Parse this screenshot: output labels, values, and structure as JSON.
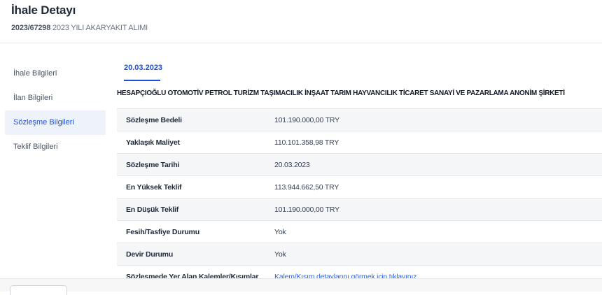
{
  "header": {
    "title": "İhale Detayı",
    "reference": "2023/67298",
    "description": "2023 YILI AKARYAKIT ALIMI"
  },
  "sidebar": {
    "items": [
      {
        "label": "İhale Bilgileri",
        "active": false
      },
      {
        "label": "İlan Bilgileri",
        "active": false
      },
      {
        "label": "Sözleşme Bilgileri",
        "active": true
      },
      {
        "label": "Teklif Bilgileri",
        "active": false
      }
    ]
  },
  "tabs": [
    {
      "label": "20.03.2023",
      "active": true
    }
  ],
  "contract": {
    "company": "HESAPÇIOĞLU OTOMOTİV PETROL TURİZM TAŞIMACILIK İNŞAAT TARIM HAYVANCILIK TİCARET SANAYİ VE PAZARLAMA ANONİM ŞİRKETİ",
    "rows": [
      {
        "label": "Sözleşme Bedeli",
        "value": "101.190.000,00 TRY"
      },
      {
        "label": "Yaklaşık Maliyet",
        "value": "110.101.358,98 TRY"
      },
      {
        "label": "Sözleşme Tarihi",
        "value": "20.03.2023"
      },
      {
        "label": "En Yüksek Teklif",
        "value": "113.944.662,50 TRY"
      },
      {
        "label": "En Düşük Teklif",
        "value": "101.190.000,00 TRY"
      },
      {
        "label": "Fesih/Tasfiye Durumu",
        "value": "Yok"
      },
      {
        "label": "Devir Durumu",
        "value": "Yok"
      },
      {
        "label": "Sözleşmede Yer Alan Kalemler/Kısımlar",
        "value": "Kalem/Kısım detaylarını görmek için tıklayınız."
      }
    ]
  },
  "colors": {
    "accent": "#1d4ed8",
    "link": "#2563eb",
    "active_bg": "#eef3fb"
  }
}
